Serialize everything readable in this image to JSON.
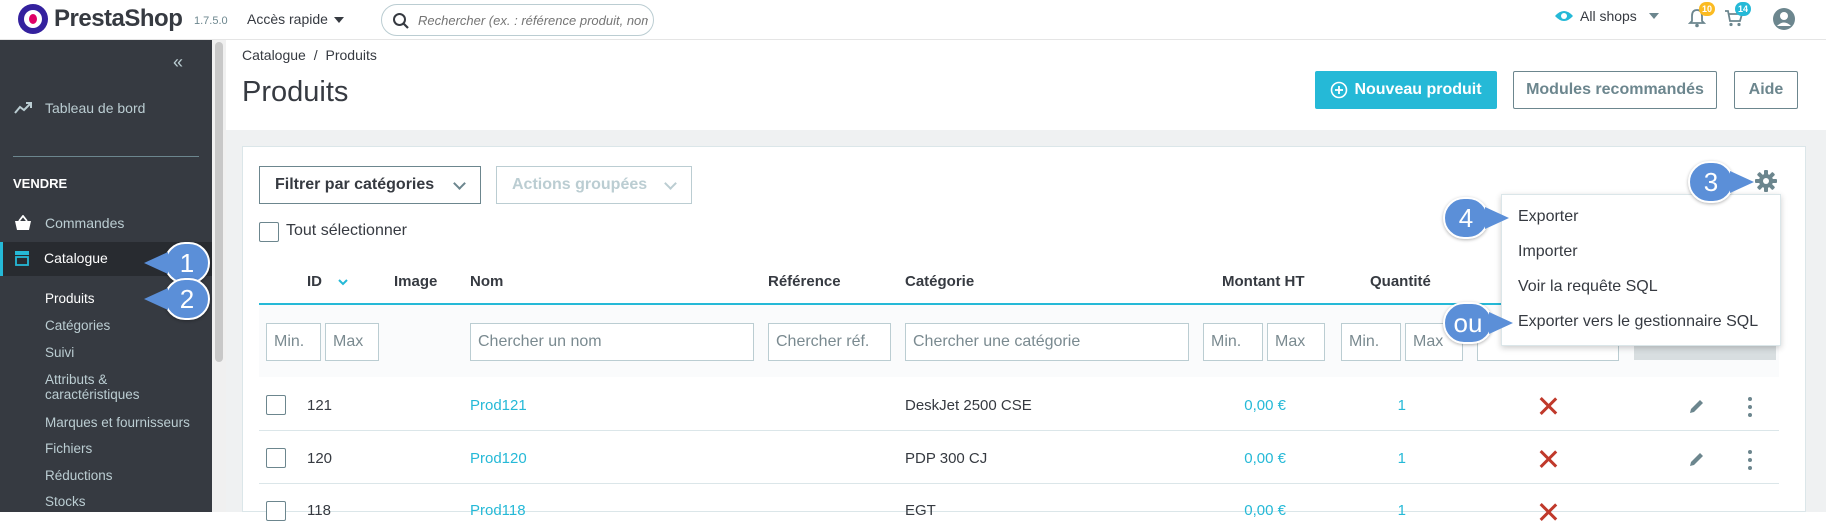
{
  "header": {
    "logo_text": "PrestaShop",
    "version": "1.7.5.0",
    "quick_access": "Accès rapide",
    "search_placeholder": "Rechercher (ex. : référence produit, nom",
    "shop_selector": "All shops",
    "notifications_badge": "10",
    "orders_badge": "14"
  },
  "sidebar": {
    "dashboard": "Tableau de bord",
    "section_sell": "VENDRE",
    "orders": "Commandes",
    "catalog": "Catalogue",
    "sub_items": [
      "Produits",
      "Catégories",
      "Suivi",
      "Attributs &",
      "caractéristiques",
      "Marques et fournisseurs",
      "Fichiers",
      "Réductions",
      "Stocks"
    ]
  },
  "breadcrumb": {
    "parent": "Catalogue",
    "separator": "/",
    "current": "Produits"
  },
  "page_title": "Produits",
  "toolbar": {
    "new_product": "Nouveau produit",
    "recommended_modules": "Modules recommandés",
    "help": "Aide"
  },
  "filters": {
    "by_category": "Filtrer par catégories",
    "bulk_actions": "Actions groupées",
    "select_all": "Tout sélectionner"
  },
  "table": {
    "columns": [
      "ID",
      "Image",
      "Nom",
      "Référence",
      "Catégorie",
      "Montant HT",
      "Quantité"
    ],
    "filter_placeholders": {
      "min": "Min.",
      "max": "Max",
      "name": "Chercher un nom",
      "reference": "Chercher réf.",
      "category": "Chercher une catégorie"
    },
    "rows": [
      {
        "id": "121",
        "name": "Prod121",
        "category": "DeskJet 2500 CSE",
        "price": "0,00 €",
        "quantity": "1"
      },
      {
        "id": "120",
        "name": "Prod120",
        "category": "PDP 300 CJ",
        "price": "0,00 €",
        "quantity": "1"
      },
      {
        "id": "118",
        "name": "Prod118",
        "category": "EGT",
        "price": "0,00 €",
        "quantity": "1"
      }
    ]
  },
  "dropdown": {
    "items": [
      "Exporter",
      "Importer",
      "Voir la requête SQL",
      "Exporter vers le gestionnaire SQL"
    ]
  },
  "callouts": [
    "1",
    "2",
    "3",
    "4",
    "ou"
  ],
  "colors": {
    "accent": "#25b9d7",
    "sidebar": "#363a41",
    "callout": "#5b8fd8",
    "danger": "#c0392b"
  }
}
